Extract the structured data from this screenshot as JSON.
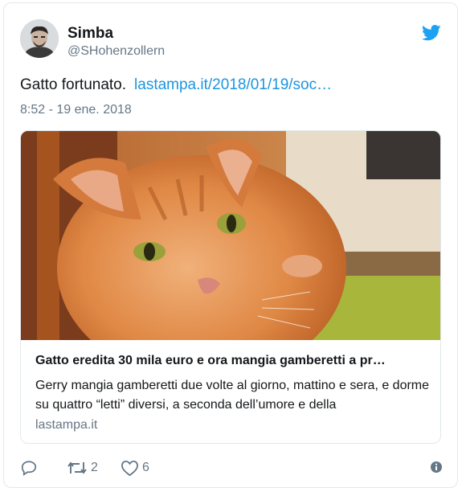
{
  "user": {
    "display_name": "Simba",
    "handle": "@SHohenzollern",
    "avatar_icon": "avatar-photo"
  },
  "header": {
    "brand_icon": "twitter-bird-icon",
    "brand_color": "#1da1f2"
  },
  "tweet": {
    "text": "Gatto fortunato.",
    "link_text": "lastampa.it/2018/01/19/soc…",
    "timestamp": "8:52 - 19 ene. 2018",
    "link_color": "#1b95e0"
  },
  "card": {
    "image_icon": "orange-cat-photo",
    "title": "Gatto eredita 30 mila euro e ora mangia gamberetti a pr…",
    "description": "Gerry mangia gamberetti due volte al giorno, mattino e sera, e dorme su quattro “letti” diversi, a seconda dell’umore e della",
    "domain": "lastampa.it"
  },
  "actions": {
    "reply_icon": "reply-icon",
    "retweet_icon": "retweet-icon",
    "retweet_count": "2",
    "like_icon": "heart-icon",
    "like_count": "6",
    "info_icon": "info-icon"
  }
}
